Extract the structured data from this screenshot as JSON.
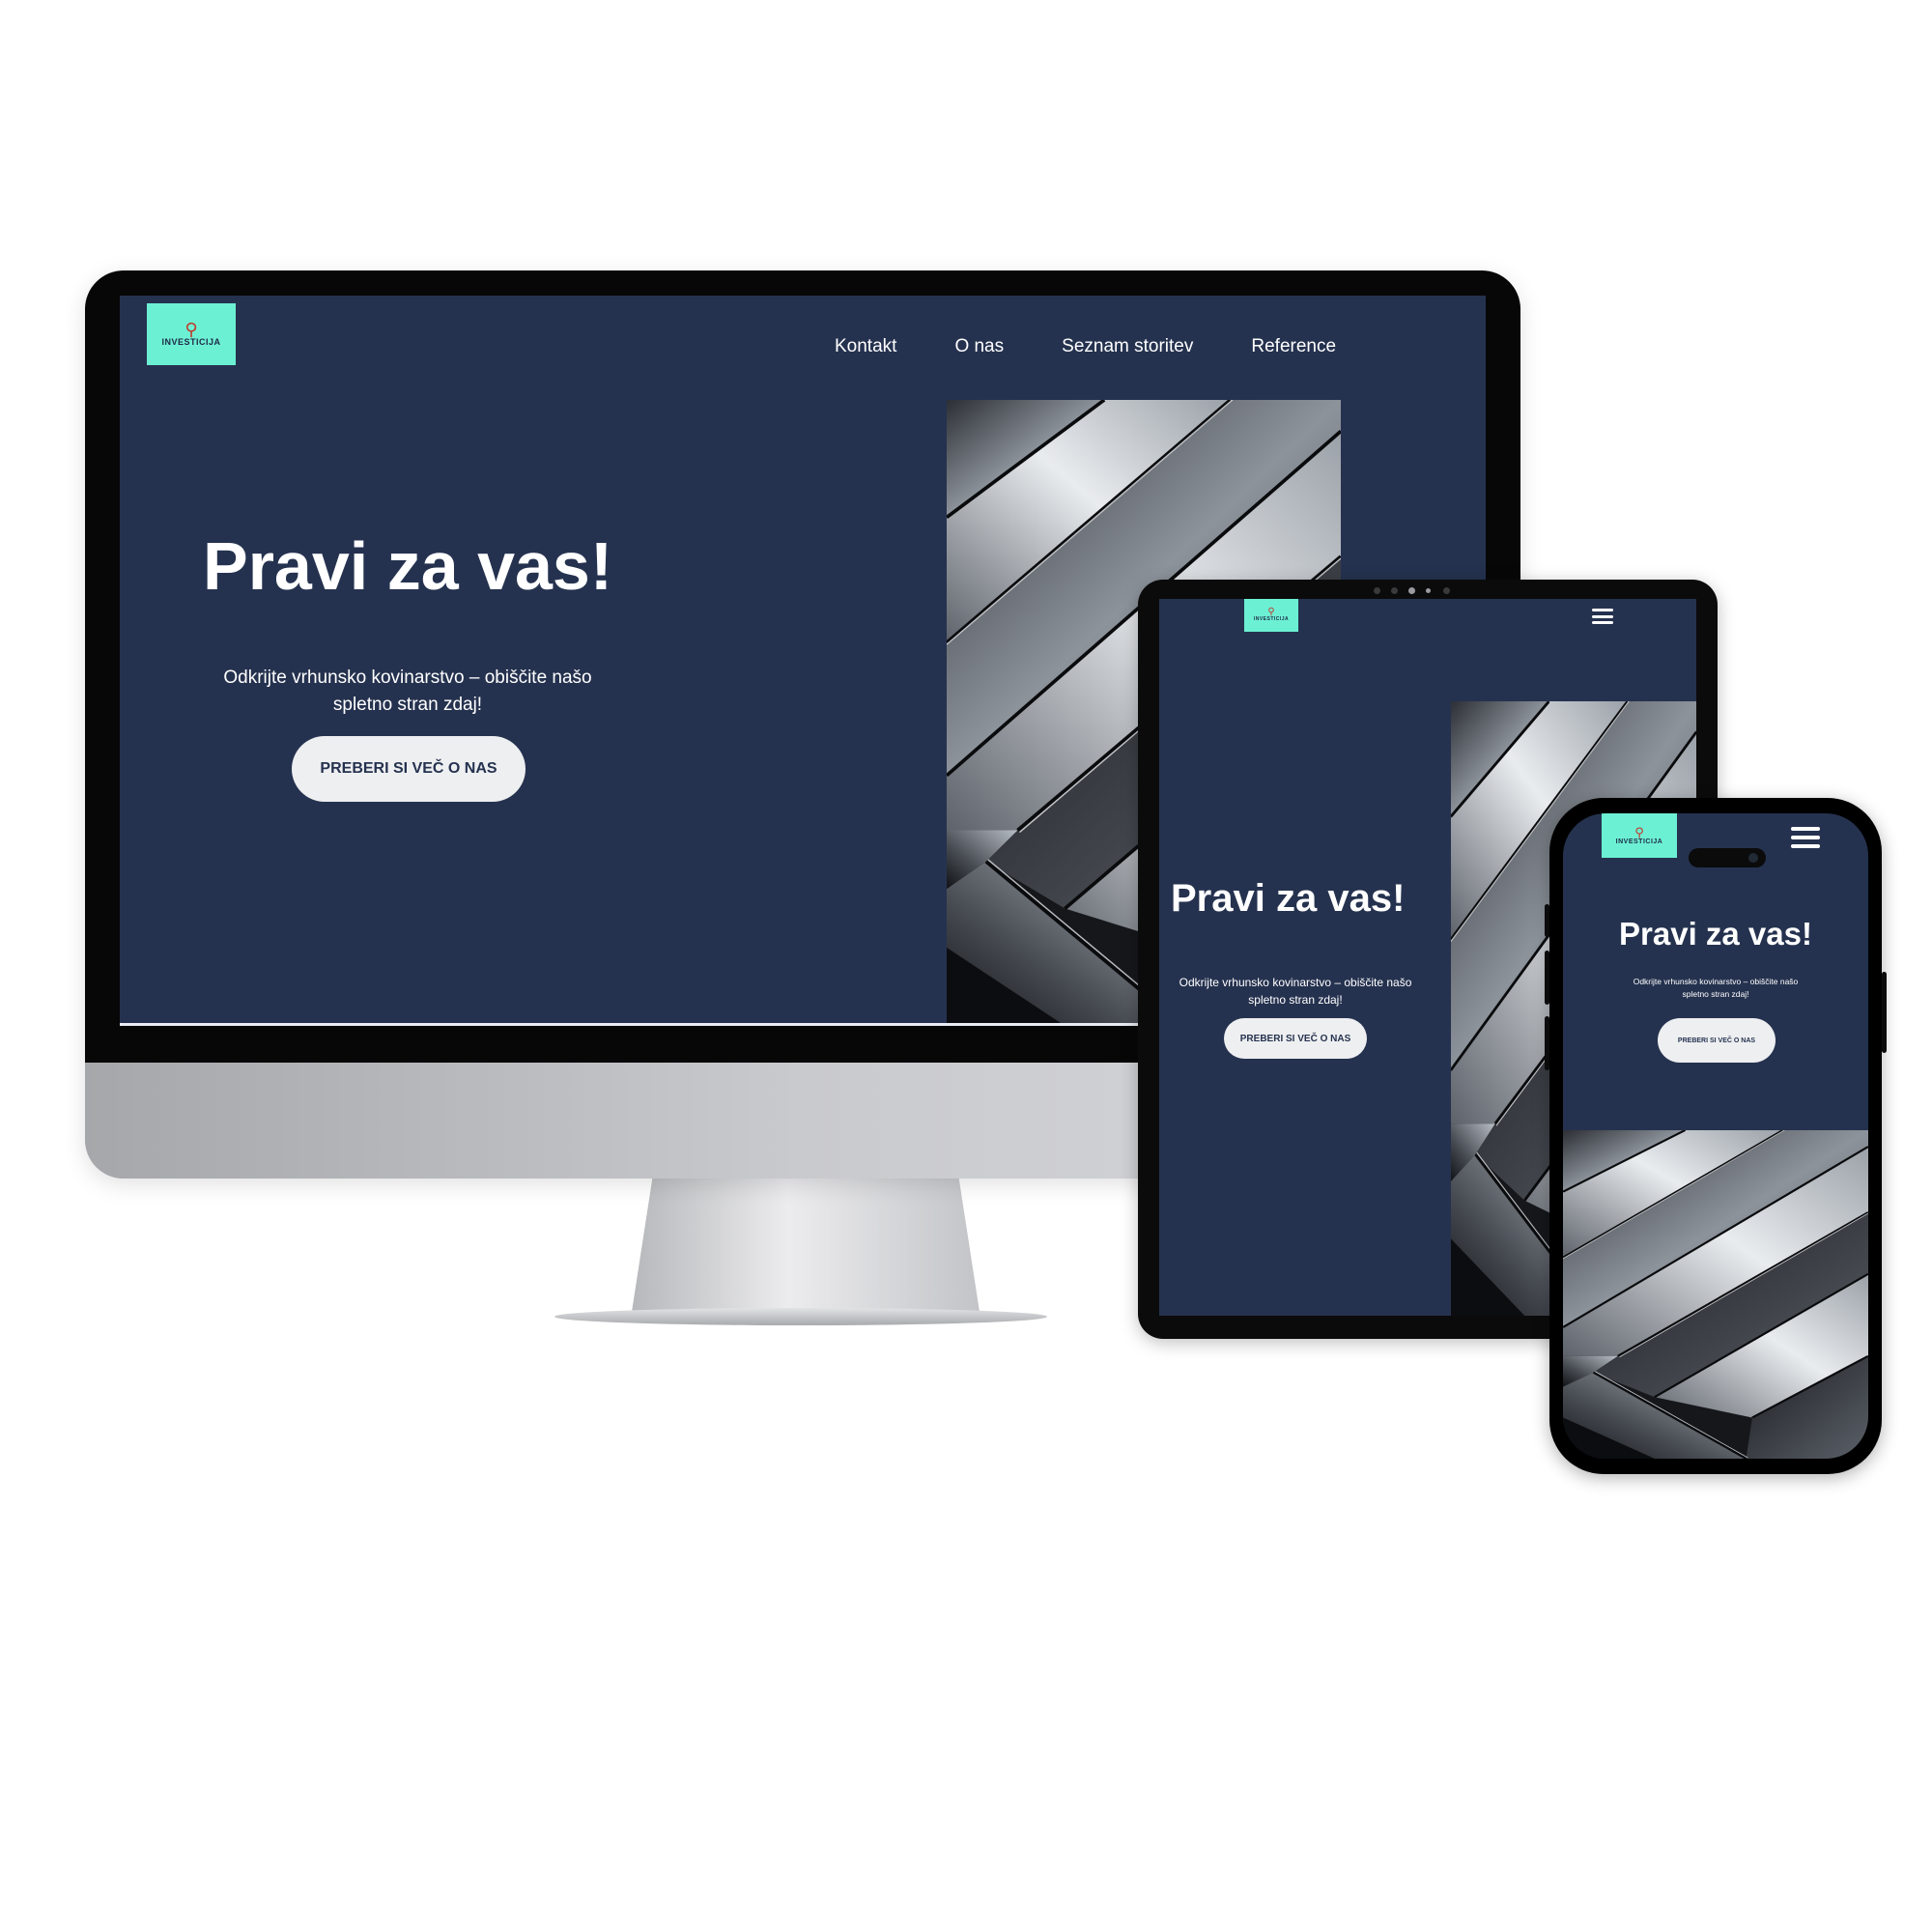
{
  "brand": {
    "logo_name": "INVESTICIJA",
    "logo_sub": "",
    "logo_color": "#6cf0d3"
  },
  "nav": {
    "items": [
      {
        "label": "Kontakt"
      },
      {
        "label": "O nas"
      },
      {
        "label": "Seznam storitev"
      },
      {
        "label": "Reference"
      }
    ]
  },
  "hero": {
    "title": "Pravi za vas!",
    "subtitle": "Odkrijte vrhunsko kovinarstvo – obiščite našo spletno stran zdaj!",
    "cta_label": "PREBERI SI VEČ O NAS"
  },
  "icons": {
    "menu": "hamburger-menu-icon",
    "logo_mark": "magnifier-icon"
  },
  "colors": {
    "page_bg": "#25324f",
    "cta_bg": "#eeeff1",
    "text": "#ffffff"
  }
}
